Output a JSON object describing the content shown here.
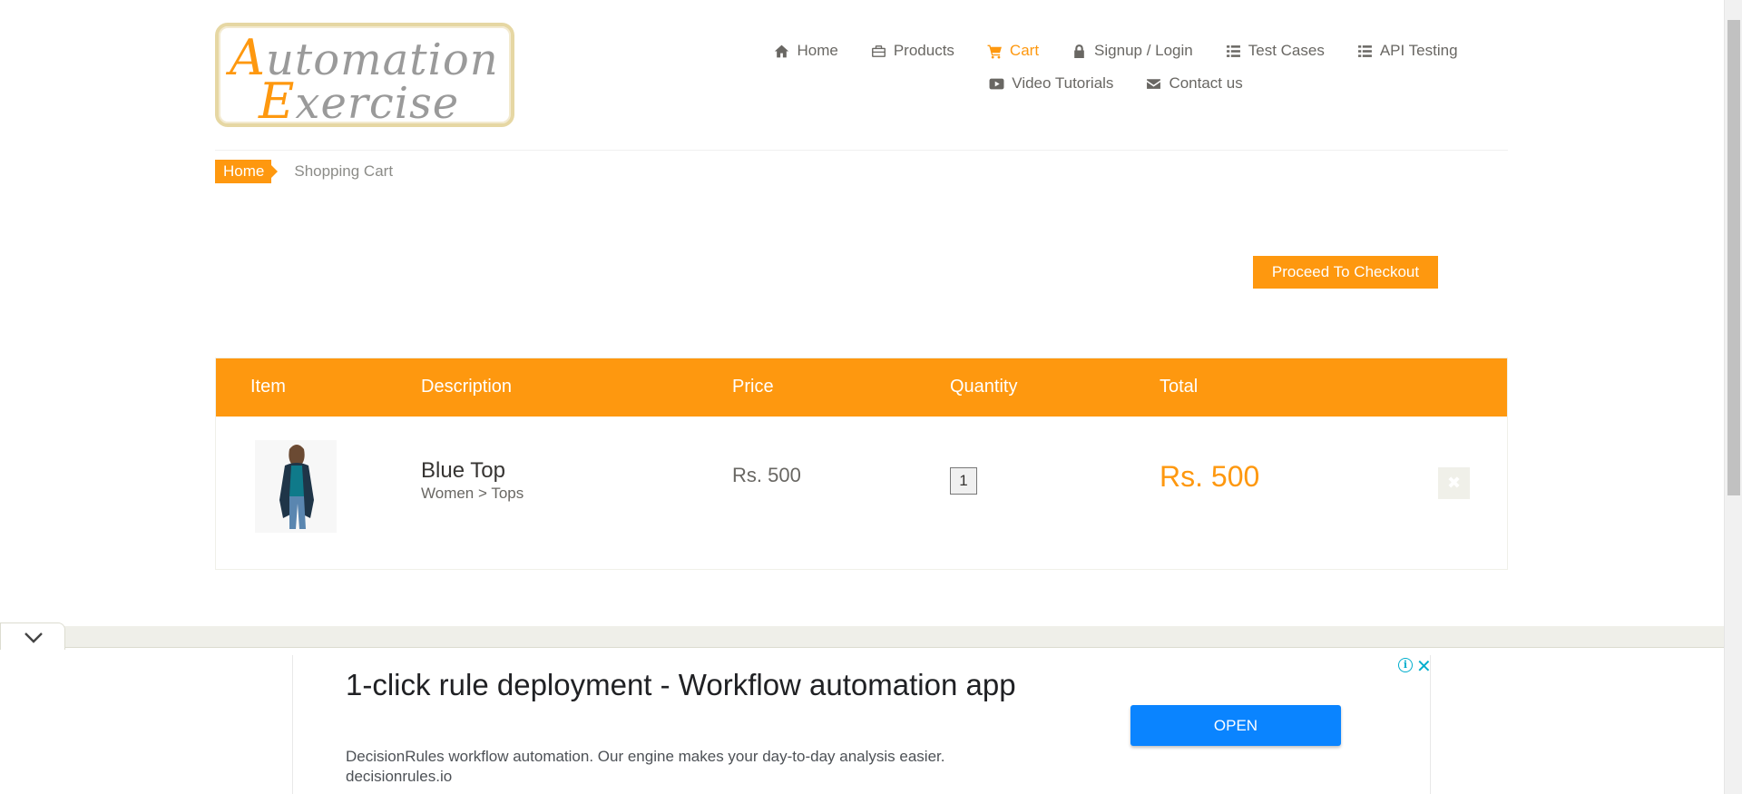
{
  "logo": {
    "line1_cap": "A",
    "line1_rest": "utomation",
    "line2_cap": "E",
    "line2_rest": "xercise"
  },
  "nav": {
    "row1": [
      {
        "label": "Home",
        "icon": "home-icon"
      },
      {
        "label": "Products",
        "icon": "briefcase-icon"
      },
      {
        "label": "Cart",
        "icon": "cart-icon",
        "active": true
      },
      {
        "label": "Signup / Login",
        "icon": "lock-icon"
      },
      {
        "label": "Test Cases",
        "icon": "list-icon"
      },
      {
        "label": "API Testing",
        "icon": "list-icon"
      }
    ],
    "row2": [
      {
        "label": "Video Tutorials",
        "icon": "youtube-play-icon"
      },
      {
        "label": "Contact us",
        "icon": "envelope-icon"
      }
    ]
  },
  "breadcrumb": {
    "home": "Home",
    "current": "Shopping Cart"
  },
  "checkout_label": "Proceed To Checkout",
  "cart": {
    "headers": {
      "item": "Item",
      "description": "Description",
      "price": "Price",
      "quantity": "Quantity",
      "total": "Total"
    },
    "rows": [
      {
        "name": "Blue Top",
        "category": "Women > Tops",
        "price": "Rs. 500",
        "quantity": "1",
        "total": "Rs. 500"
      }
    ]
  },
  "ad": {
    "title": "1-click rule deployment - Workflow automation app",
    "description": "DecisionRules workflow automation. Our engine makes your day-to-day analysis easier.",
    "domain": "decisionrules.io",
    "open_label": "OPEN",
    "info_icon": "i",
    "close_icon": "✕"
  },
  "colors": {
    "accent": "#fe980f",
    "text": "#696763",
    "ad_button": "#0a84ff"
  }
}
